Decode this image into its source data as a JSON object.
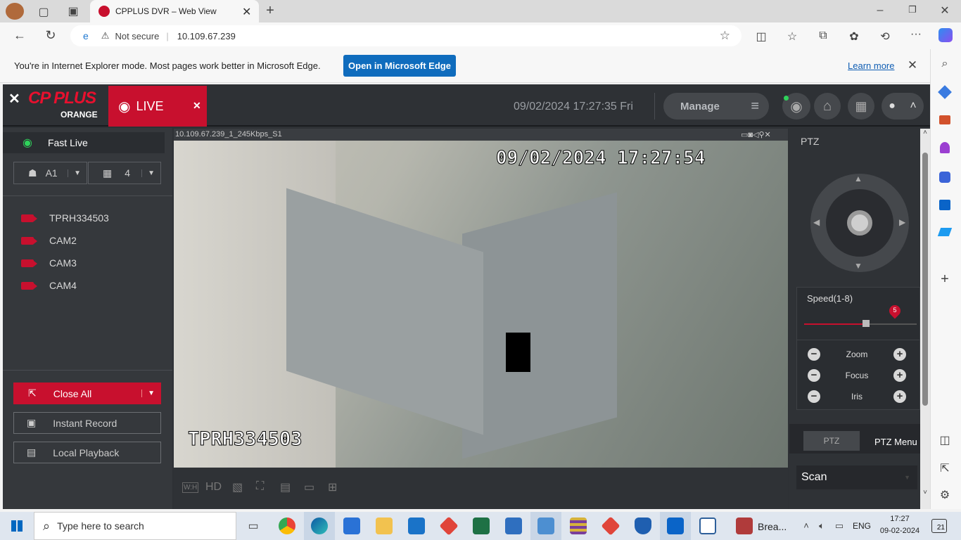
{
  "browser": {
    "tab_title": "CPPLUS DVR – Web View",
    "security": "Not secure",
    "url": "10.109.67.239"
  },
  "ie_bar": {
    "message": "You're in Internet Explorer mode. Most pages work better in Microsoft Edge.",
    "open_button": "Open in Microsoft Edge",
    "learn_more": "Learn more"
  },
  "app": {
    "logo_top": "CP PLUS",
    "logo_bottom": "ORANGE",
    "live_tab": "LIVE",
    "datetime": "09/02/2024 17:27:35 Fri",
    "manage": "Manage"
  },
  "left": {
    "fast_live": "Fast Live",
    "group": "A1",
    "split": "4",
    "cameras": [
      "TPRH334503",
      "CAM2",
      "CAM3",
      "CAM4"
    ],
    "close_all": "Close All",
    "instant_record": "Instant Record",
    "local_playback": "Local Playback"
  },
  "video": {
    "channel_label": "10.109.67.239_1_245Kbps_S1",
    "osd_datetime": "09/02/2024 17:27:54",
    "osd_name": "TPRH334503",
    "toolbar": [
      "W:H",
      "HD"
    ]
  },
  "ptz": {
    "title": "PTZ",
    "speed_label": "Speed(1-8)",
    "speed_value": "5",
    "speed": 5,
    "zoom": "Zoom",
    "focus": "Focus",
    "iris": "Iris",
    "tab_ptz": "PTZ",
    "tab_menu": "PTZ Menu",
    "scan": "Scan"
  },
  "taskbar": {
    "search_placeholder": "Type here to search",
    "app_label": "Brea...",
    "lang": "ENG",
    "time": "17:27",
    "date": "09-02-2024",
    "notifications": "21"
  }
}
